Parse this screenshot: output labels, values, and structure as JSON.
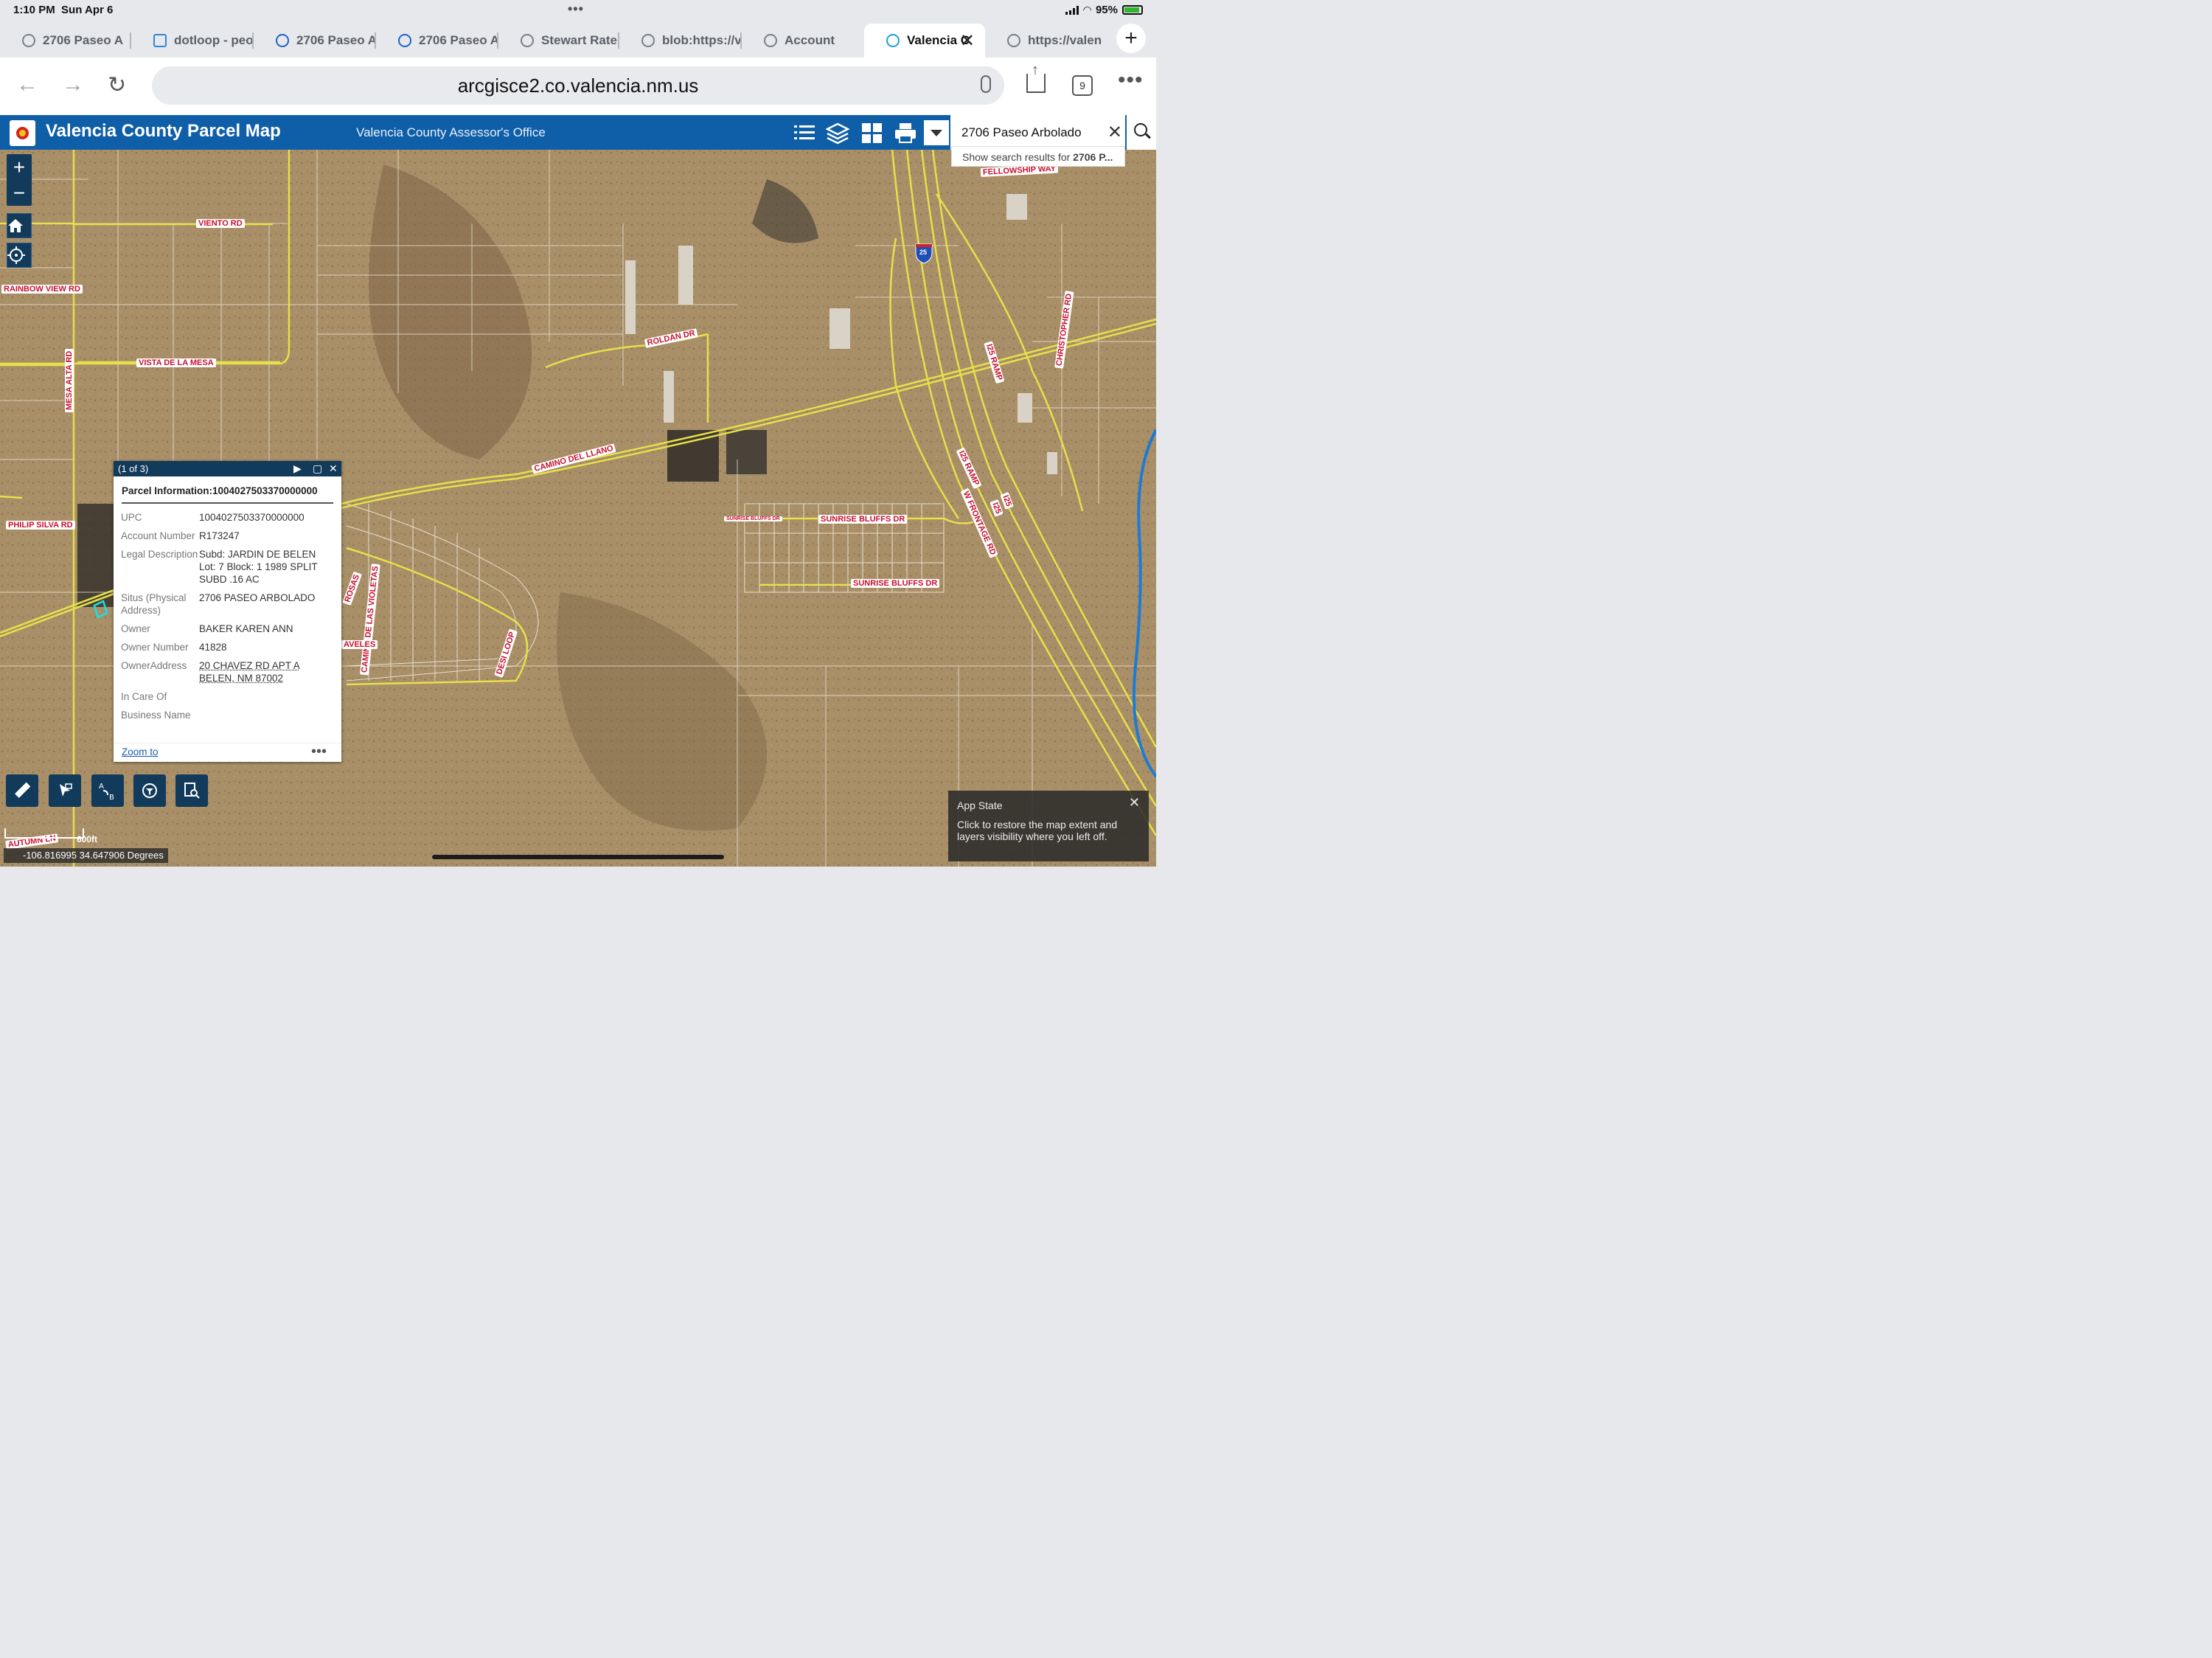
{
  "status": {
    "time": "1:10 PM",
    "date": "Sun Apr 6",
    "battery": "95%",
    "dots": "•••"
  },
  "tabs": [
    {
      "label": "2706 Paseo A",
      "active": false
    },
    {
      "label": "dotloop - peo",
      "active": false
    },
    {
      "label": "2706 Paseo A",
      "active": false
    },
    {
      "label": "2706 Paseo A",
      "active": false
    },
    {
      "label": "Stewart Rate",
      "active": false
    },
    {
      "label": "blob:https://v",
      "active": false
    },
    {
      "label": "Account",
      "active": false
    },
    {
      "label": "Valencia C",
      "active": true
    },
    {
      "label": "https://valen",
      "active": false
    }
  ],
  "browser": {
    "url": "arcgisce2.co.valencia.nm.us",
    "tab_count": "9",
    "back": "←",
    "forward": "→",
    "reload": "↻",
    "new_tab": "+",
    "close": "✕",
    "more": "•••"
  },
  "app": {
    "title": "Valencia County Parcel Map",
    "subtitle": "Valencia County Assessor's Office",
    "search_value": "2706 Paseo Arbolado",
    "suggestion_prefix": "Show search results for ",
    "suggestion_bold": "2706 P...",
    "clear": "✕",
    "colors": {
      "header": "#0f5ea8",
      "widget": "#123a5a"
    }
  },
  "map_labels": {
    "viento": "VIENTO RD",
    "rainbow": "RAINBOW VIEW RD",
    "vista": "VISTA DE LA MESA",
    "mesa_alta": "MESA ALTA RD",
    "philip": "PHILIP SILVA RD",
    "roldan": "ROLDAN DR",
    "camino_llano": "CAMINO DEL LLANO",
    "fellowship": "FELLOWSHIP WAY",
    "christopher": "CHRISTOPHER RD",
    "i25_ramp1": "I25 RAMP",
    "i25_ramp2": "I25 RAMP",
    "frontage": "W FRONTAGE RD",
    "i25a": "I25",
    "i25b": "I25",
    "interstate_shield": "25",
    "sunrise1": "SUNRISE BLUFFS DR",
    "sunrise2": "SUNRISE BLUFFS DR",
    "sunrise_small": "SUNRISE BLUFFS DR",
    "violetas": "CAMINO DE LAS VIOLETAS",
    "desi": "DESI LOOP",
    "claveles": "AVELES",
    "rosas": "ROSAS",
    "autumn": "AUTUMN LN"
  },
  "popup": {
    "counter": "(1 of 3)",
    "title": "Parcel Information:1004027503370000000",
    "fields": [
      {
        "key": "UPC",
        "value": "1004027503370000000"
      },
      {
        "key": "Account Number",
        "value": "R173247"
      },
      {
        "key": "Legal Description",
        "value": "Subd: JARDIN DE BELEN Lot: 7 Block: 1 1989 SPLIT SUBD .16 AC"
      },
      {
        "key": "Situs (Physical Address)",
        "value": "2706 PASEO ARBOLADO"
      },
      {
        "key": "Owner",
        "value": "BAKER KAREN ANN"
      },
      {
        "key": "Owner Number",
        "value": "41828"
      },
      {
        "key": "OwnerAddress",
        "value": "20 CHAVEZ RD APT A BELEN, NM 87002"
      },
      {
        "key": "In Care Of",
        "value": ""
      },
      {
        "key": "Business Name",
        "value": ""
      }
    ],
    "zoom_to": "Zoom to",
    "more": "•••",
    "play": "▶",
    "maximize": "▢",
    "close": "✕"
  },
  "map_controls": {
    "zoom_in": "+",
    "zoom_out": "−"
  },
  "scale": {
    "label": "600ft"
  },
  "coords": {
    "text": "-106.816995 34.647906 Degrees"
  },
  "app_state": {
    "title": "App State",
    "message": "Click to restore the map extent and layers visibility where you left off.",
    "close": "✕"
  }
}
